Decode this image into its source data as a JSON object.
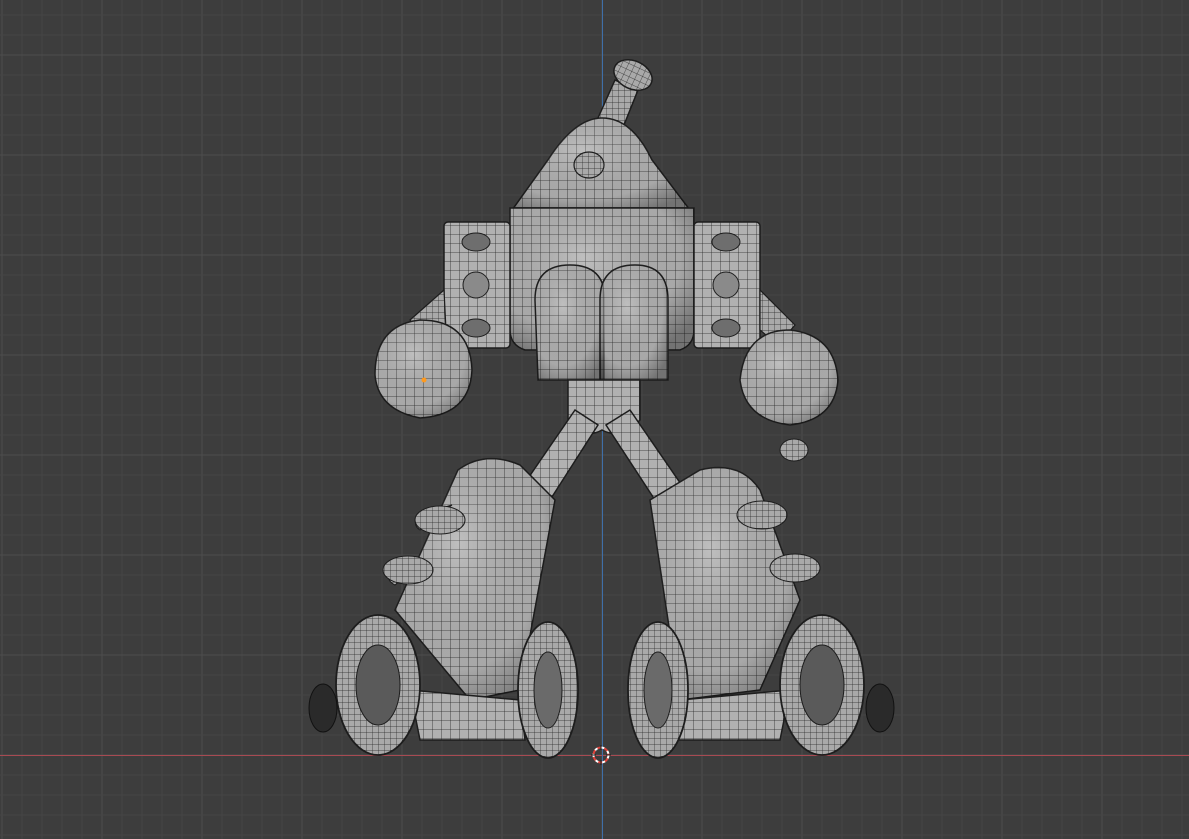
{
  "viewport": {
    "name": "3D Viewport",
    "shading": "wireframe-over-solid",
    "view": "front-orthographic",
    "background_color": "#3d3d3d",
    "grid_minor_color": "#454545",
    "grid_major_color": "#4d4d4d",
    "x_axis_color": "#a84a52",
    "z_axis_color": "#3f6fa8",
    "mesh_color": "#b4b4b4",
    "wire_color": "#1e1e1e",
    "origin_dot_color": "#ff9a1e"
  },
  "scene": {
    "object": "robot-character",
    "parts": [
      "antenna",
      "head-dome",
      "torso",
      "shoulder-blocks",
      "arms",
      "hands",
      "hips",
      "legs",
      "foot-spikes",
      "wheels",
      "axle-hubs"
    ],
    "cursor": "3d-cursor",
    "origin_marker": "object-origin"
  }
}
